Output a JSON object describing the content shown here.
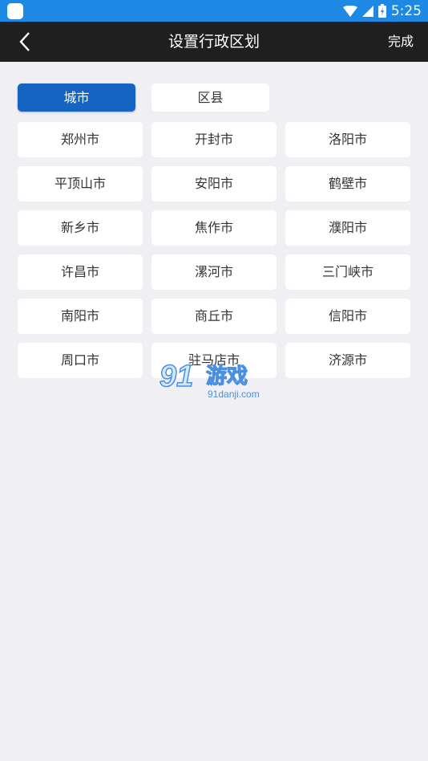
{
  "status_bar": {
    "time": "5:25"
  },
  "nav": {
    "title": "设置行政区划",
    "done_label": "完成"
  },
  "tabs": [
    {
      "label": "城市",
      "active": true
    },
    {
      "label": "区县",
      "active": false
    }
  ],
  "cities": [
    "郑州市",
    "开封市",
    "洛阳市",
    "平顶山市",
    "安阳市",
    "鹤壁市",
    "新乡市",
    "焦作市",
    "濮阳市",
    "许昌市",
    "漯河市",
    "三门峡市",
    "南阳市",
    "商丘市",
    "信阳市",
    "周口市",
    "驻马店市",
    "济源市"
  ],
  "watermark": {
    "text": "91游戏",
    "url": "91danji.com"
  },
  "colors": {
    "status_bar": "#1e88e5",
    "nav_bar": "#1f1f1f",
    "accent": "#1565c0",
    "background": "#efeff4"
  }
}
